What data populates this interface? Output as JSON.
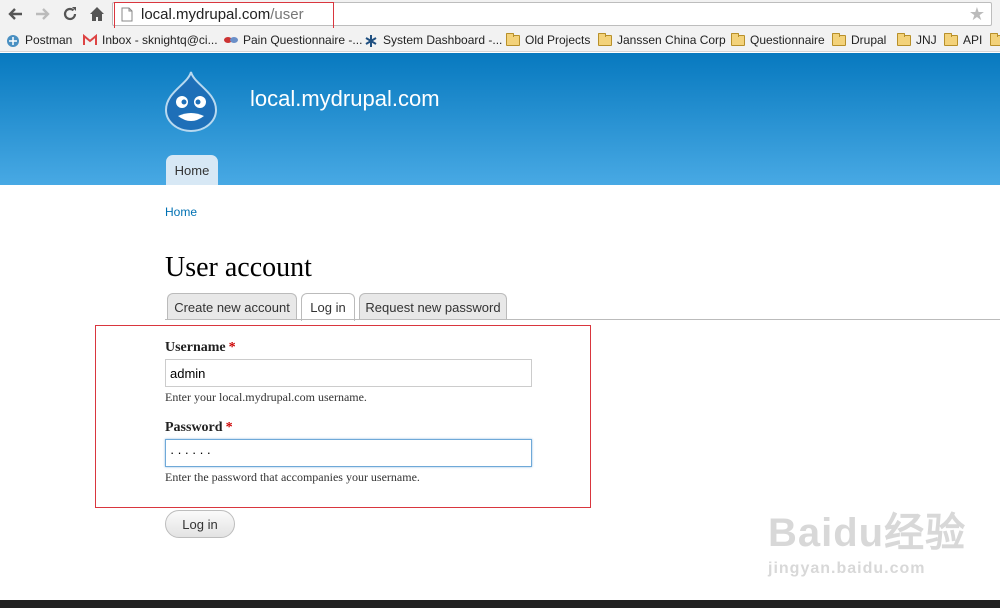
{
  "browser": {
    "url_host": "local.mydrupal.com",
    "url_path": "/user",
    "bookmarks": [
      {
        "label": "Postman",
        "icon": "postman-icon"
      },
      {
        "label": "Inbox - sknightq@ci...",
        "icon": "gmail-icon"
      },
      {
        "label": "Pain Questionnaire -...",
        "icon": "pills-icon"
      },
      {
        "label": "System Dashboard -...",
        "icon": "jira-icon"
      },
      {
        "label": "Old Projects",
        "icon": "folder-icon"
      },
      {
        "label": "Janssen China Corp",
        "icon": "folder-icon"
      },
      {
        "label": "Questionnaire",
        "icon": "folder-icon"
      },
      {
        "label": "Drupal",
        "icon": "folder-icon"
      },
      {
        "label": "JNJ",
        "icon": "folder-icon"
      },
      {
        "label": "API",
        "icon": "folder-icon"
      }
    ]
  },
  "header": {
    "site_name": "local.mydrupal.com",
    "nav": {
      "home": "Home"
    }
  },
  "main": {
    "breadcrumb": "Home",
    "title": "User account",
    "tabs": [
      {
        "label": "Create new account",
        "active": false
      },
      {
        "label": "Log in",
        "active": true
      },
      {
        "label": "Request new password",
        "active": false
      }
    ],
    "form": {
      "username_label": "Username",
      "username_value": "admin",
      "username_desc": "Enter your local.mydrupal.com username.",
      "password_label": "Password",
      "password_value": "······",
      "password_desc": "Enter the password that accompanies your username.",
      "required_mark": "*",
      "submit": "Log in"
    }
  },
  "watermark": {
    "main": "Baidu经验",
    "sub": "jingyan.baidu.com"
  },
  "colors": {
    "header_top": "#0779bf",
    "header_bottom": "#48a9e4",
    "link": "#0071b3",
    "highlight": "#d9363e"
  }
}
